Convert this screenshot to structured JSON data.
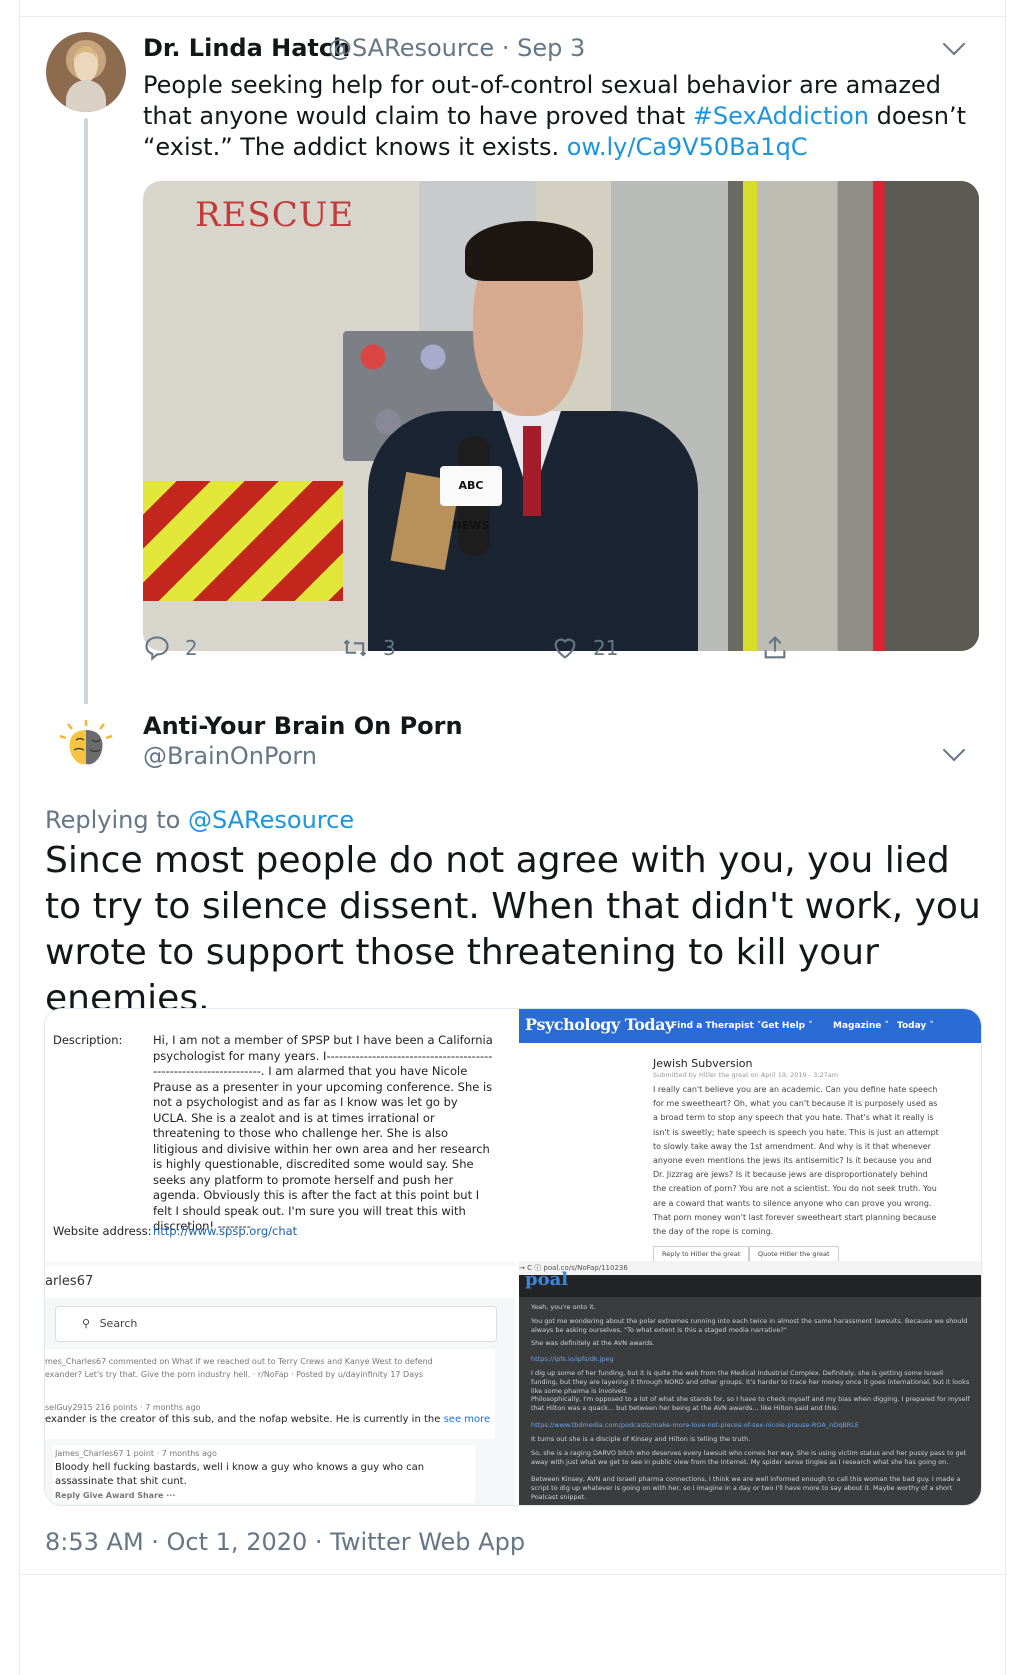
{
  "tweet1": {
    "name": "Dr. Linda Hatch",
    "handle": "@SAResource",
    "date": "Sep 3",
    "text_before": "People seeking help for out-of-control sexual behavior are amazed that anyone would claim to have proved that ",
    "hashtag": "#SexAddiction",
    "text_after": " doesn’t “exist.” The addict knows it exists. ",
    "link": "ow.ly/Ca9V50Ba1qC",
    "image": {
      "sign_text": "RESCUE",
      "mic_flag": "ABC NEWS"
    },
    "actions": {
      "replies": "2",
      "retweets": "3",
      "likes": "21"
    }
  },
  "tweet2": {
    "name": "Anti-Your Brain On Porn",
    "handle": "@BrainOnPorn",
    "replying_label": "Replying to ",
    "replying_to": "@SAResource",
    "text": "Since most people do not agree with you, you lied to try to silence dissent. When that didn't work, you wrote to support those threatening to kill your enemies.",
    "footer": "8:53 AM · Oct 1, 2020 · Twitter Web App"
  },
  "collage": {
    "form": {
      "desc_label": "Description:",
      "desc_text": "Hi, I am not a member of SPSP but I have been a California psychologist for many years. I------------------------------------------------------------------. I am alarmed that you have Nicole Prause as a presenter in your upcoming conference. She is not a psychologist and as far as I know was let go by UCLA. She is a zealot and is at times irrational or threatening to those who challenge her. She is also litigious and divisive within her own area and her research is highly questionable, discredited some would say. She seeks any platform to promote herself and push her agenda. Obviously this is after the fact at this point but I felt I should speak out. I'm sure you will treat this with discretion! --------",
      "web_label": "Website address:",
      "web_value": "http://www.spsp.org/chat"
    },
    "pt": {
      "logo": "Psychology Today",
      "nav": [
        "Find a Therapist ˅",
        "Get Help ˅",
        "Magazine ˅",
        "Today ˅"
      ],
      "title": "Jewish Subversion",
      "submitted": "Submitted by Hitler the great on April 19, 2019 - 3:27am",
      "body": "I really can't believe you are an academic. Can you define hate speech for me sweetheart? Oh, what you can't because it is purposely used as a broad term to stop any speech that you hate. That's what it really is isn't is sweetly; hate speech is speech you hate. This is just an attempt to slowly take away the 1st amendment. And why is it that whenever anyone even mentions the jews its antisemitic? Is it because you and Dr. Jizzrag are jews? Is it because jews are disproportionately behind the creation of porn? You are not a scientist. You do not seek truth. You are a coward that wants to silence anyone who can prove you wrong. That porn money won't last forever sweetheart start planning because the day of the rope is coming.",
      "btn1": "Reply to Hitler the great",
      "btn2": "Quote Hitler the great"
    },
    "reddit": {
      "user": "arles67",
      "search": "Search",
      "c1_meta": "mes_Charles67 commented on What if we reached out to Terry Crews and Kanye West to defend exander? Let's try that. Give the porn industry hell. · r/NoFap · Posted by u/dayinfinity  17 Days",
      "c2_meta": "selGuy2915  216 points · 7 months ago",
      "c2_text": "exander is the creator of this sub, and the nofap website. He is currently in the ",
      "c2_more": "see more",
      "c3_meta": "James_Charles67  1 point · 7 months ago",
      "c3_text": "Bloody hell fucking bastards, well i know a guy who knows a guy who can assassinate that shit cunt.",
      "c3_actions": "Reply   Give Award   Share   ···"
    },
    "poal": {
      "url": "→  C   ⓘ  poal.co/s/NoFap/110236",
      "logo": "poal",
      "lines": [
        "Yeah, you're onto it.",
        "You got me wondering about the polar extremes running into each twice in almost the same harassment lawsuits. Because we should always be asking ourselves, \"To what extent is this a staged media narrative?\"",
        "She was definitely at the AVN awards.",
        "https://ipfs.io/ipfs/dk.jpeg",
        "I dig up some of her funding, but it is quite the web from the Medical Industrial Complex. Definitely, she is getting some Israeli funding, but they are layering it through NORD and other groups. It's harder to trace her money once it goes international, but it looks like some pharma is involved.",
        "Philosophically, I'm opposed to a lot of what she stands for, so I have to check myself and my bias when digging. I prepared for myself that Hilton was a quack... but between her being at the AVN awards... like Hilton said and this:",
        "https://www.tbdmedia.com/podcasts/make-more-love-not-pieces-of-sex-nicole-prause-ROA_nDqBRLE",
        "It turns out she is a disciple of Kinsey and Hilton is telling the truth.",
        "So, she is a raging DARVO bitch who deserves every lawsuit who comes her way. She is using victim status and her pussy pass to get away with just what we get to see in public view from the Internet. My spider sense tingles as I research what she has going on.",
        "Between Kinsey, AVN and Israeli pharma connections, I think we are well informed enough to call this woman the bad guy. I made a script to dig up whatever is going on with her, so I imagine in a day or two I'll have more to say about it. Maybe worthy of a short Poalcast snippet."
      ]
    }
  }
}
